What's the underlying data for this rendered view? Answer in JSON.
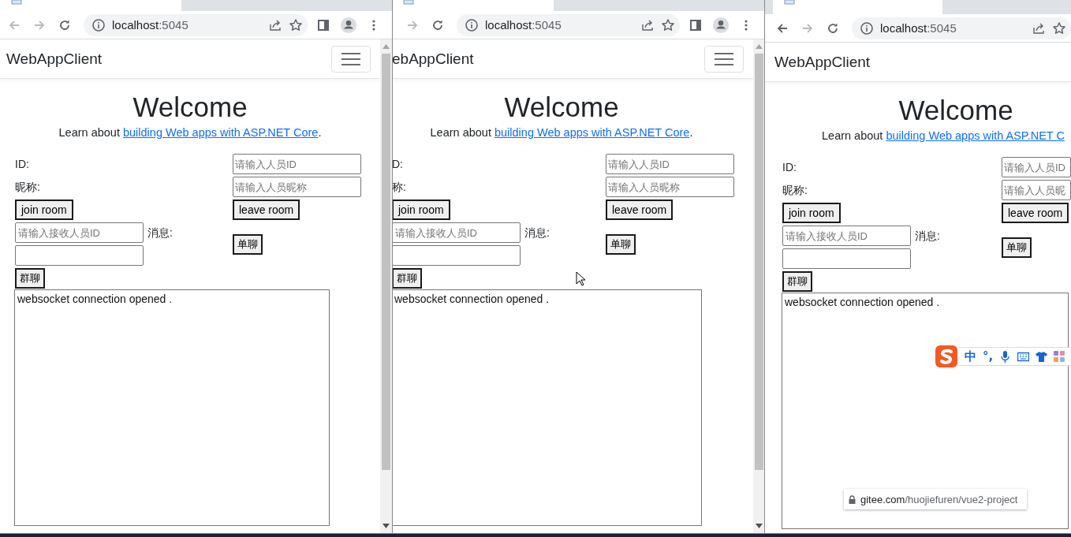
{
  "windows": [
    {
      "toolbar": {
        "back": {
          "disabled": true
        },
        "forward": {
          "disabled": true
        },
        "url_host": "localhost",
        "url_port": ":5045",
        "panel_buttons": true
      },
      "brand": "WebAppClient",
      "menu_button": true,
      "scrollbar": true,
      "heading": "Welcome",
      "intro": "Learn about ",
      "link": "building Web apps with ASP.NET Core",
      "intro_end": ".",
      "form": {
        "id_label": "ID:",
        "id_placeholder": "请输入人员ID",
        "nick_label": "昵称:",
        "nick_placeholder": "请输入人员昵称",
        "join": "join room",
        "leave": "leave room",
        "receiver_placeholder": "请输入接收人员ID",
        "message_label": "消息:",
        "private_chat": "单聊",
        "group_chat": "群聊"
      },
      "log": [
        "websocket connection opened ."
      ]
    },
    {
      "toolbar": {
        "forward": {
          "disabled": true
        },
        "url_host": "localhost",
        "url_port": ":5045",
        "panel_buttons": true
      },
      "brand": "ebAppClient",
      "menu_button": true,
      "scrollbar": true,
      "heading": "Welcome",
      "intro": "Learn about ",
      "link": "building Web apps with ASP.NET Core",
      "intro_end": ".",
      "form": {
        "id_label": "D:",
        "id_placeholder": "请输入人员ID",
        "nick_label": "称:",
        "nick_placeholder": "请输入人员昵称",
        "join": "join room",
        "leave": "leave room",
        "receiver_placeholder": "请输入接收人员ID",
        "message_label": "消息:",
        "private_chat": "单聊",
        "group_chat": "群聊"
      },
      "log": [
        "websocket connection opened ."
      ],
      "cursor": true
    },
    {
      "toolbar": {
        "back": {
          "disabled": false
        },
        "forward": {
          "disabled": true
        },
        "url_host": "localhost",
        "url_port": ":5045",
        "panel_buttons": false
      },
      "brand": "WebAppClient",
      "menu_button": false,
      "scrollbar": false,
      "heading": "Welcome",
      "intro": "Learn about ",
      "link": "building Web apps with ASP.NET C",
      "form": {
        "id_label": "ID:",
        "id_placeholder": "请输入人员ID",
        "nick_label": "昵称:",
        "nick_placeholder": "请输入人员昵",
        "join": "join room",
        "leave": "leave room",
        "receiver_placeholder": "请输入接收人员ID",
        "message_label": "消息:",
        "private_chat": "单聊",
        "group_chat": "群聊"
      },
      "log": [
        "websocket connection opened ."
      ],
      "ime_toolbar": {
        "mode": "中",
        "punctuation": "°,"
      },
      "status_url": {
        "host": "gitee.com",
        "path": "/huojiefuren/vue2-project"
      }
    }
  ]
}
